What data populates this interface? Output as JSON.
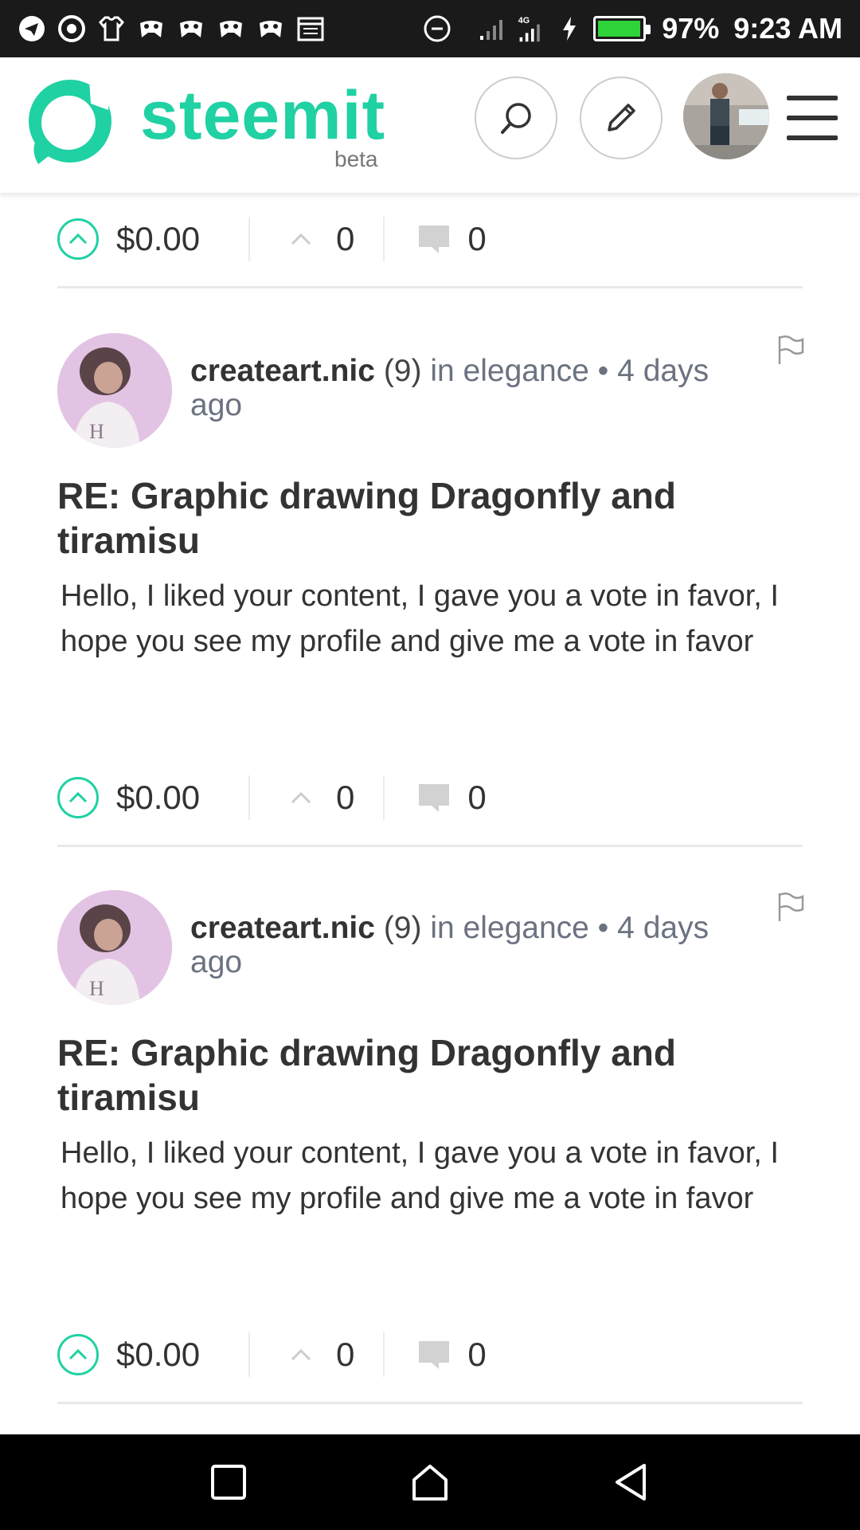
{
  "status_bar": {
    "battery": "97%",
    "time": "9:23 AM",
    "network": "4G",
    "battery_level": 0.97,
    "icons": [
      "telegram-icon",
      "chrome-icon",
      "shirt-icon",
      "game-controller-icon",
      "game-controller-icon",
      "game-controller-icon",
      "game-controller-icon",
      "calendar-icon",
      "dnd-icon",
      "signal-icon",
      "signal-4g-icon",
      "charging-icon",
      "battery-icon"
    ]
  },
  "header": {
    "brand": "steemit",
    "beta": "beta",
    "brand_color": "#1fd1a3"
  },
  "top_footer": {
    "payout": "$0.00",
    "votes": "0",
    "comments": "0"
  },
  "posts": [
    {
      "author": "createart.nic",
      "reputation": "(9)",
      "community": "in elegance",
      "time": "4 days ago",
      "title": "RE: Graphic drawing Dragonfly and tiramisu",
      "body": "Hello, I liked your content, I gave you a vote in favor, I hope you see my profile and give me a vote in favor",
      "payout": "$0.00",
      "votes": "0",
      "comments": "0"
    },
    {
      "author": "createart.nic",
      "reputation": "(9)",
      "community": "in elegance",
      "time": "4 days ago",
      "title": "RE: Graphic drawing Dragonfly and tiramisu",
      "body": "Hello, I liked your content, I gave you a vote in favor, I hope you see my profile and give me a vote in favor",
      "payout": "$0.00",
      "votes": "0",
      "comments": "0"
    }
  ],
  "colors": {
    "accent": "#1fd1a3",
    "text": "#333333",
    "muted": "#6b7280"
  }
}
